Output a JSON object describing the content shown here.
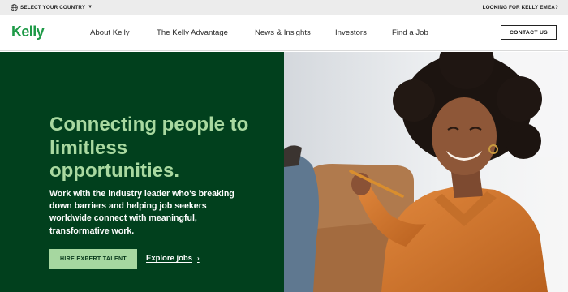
{
  "utility": {
    "country_label": "SELECT YOUR COUNTRY",
    "emea_label": "LOOKING FOR KELLY EMEA?"
  },
  "header": {
    "logo": "Kelly",
    "nav": [
      "About Kelly",
      "The Kelly Advantage",
      "News & Insights",
      "Investors",
      "Find a Job"
    ],
    "contact_label": "CONTACT US"
  },
  "hero": {
    "title": "Connecting people to limitless opportunities.",
    "description": "Work with the industry leader who's breaking down barriers and helping job seekers worldwide connect with meaningful, transformative work.",
    "primary_cta": "HIRE EXPERT TALENT",
    "secondary_cta": "Explore jobs"
  },
  "colors": {
    "brand_green": "#1e9a47",
    "hero_bg": "#01401d",
    "hero_title": "#a9d9a0",
    "cta_bg": "#a6d7a0"
  },
  "icons": {
    "country": "globe-icon",
    "caret": "caret-down-icon",
    "link_arrow": "chevron-right-icon"
  }
}
